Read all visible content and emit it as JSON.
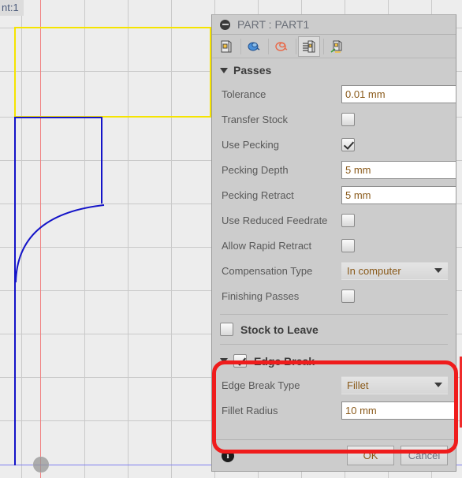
{
  "viewport": {
    "label": "nt:1",
    "origin_icon": "origin-marker-icon",
    "stock_color": "#f5e400",
    "profile_color": "#1414c8",
    "x_axis_color": "#f08080",
    "y_axis_color": "#8080f0",
    "grid_color": "#c9c9c9",
    "background": "#ededed"
  },
  "dialog": {
    "title": "PART : PART1",
    "title_icon": "minus-circle-icon",
    "toolbar": [
      {
        "name": "tool-tab-icon",
        "selected": false
      },
      {
        "name": "geometry-tab-icon",
        "selected": false
      },
      {
        "name": "heights-tab-icon",
        "selected": false
      },
      {
        "name": "passes-tab-icon",
        "selected": true
      },
      {
        "name": "linking-tab-icon",
        "selected": false
      }
    ],
    "groups": [
      {
        "name": "passes",
        "title": "Passes",
        "expanded": true,
        "rows": [
          {
            "type": "spinner",
            "label": "Tolerance",
            "value": "0.01 mm"
          },
          {
            "type": "checkbox",
            "label": "Transfer Stock",
            "checked": false
          },
          {
            "type": "checkbox",
            "label": "Use Pecking",
            "checked": true
          },
          {
            "type": "spinner",
            "label": "Pecking Depth",
            "value": "5 mm"
          },
          {
            "type": "spinner",
            "label": "Pecking Retract",
            "value": "5 mm"
          },
          {
            "type": "checkbox",
            "label": "Use Reduced Feedrate",
            "checked": false
          },
          {
            "type": "checkbox",
            "label": "Allow Rapid Retract",
            "checked": false
          },
          {
            "type": "dropdown",
            "label": "Compensation Type",
            "value": "In computer"
          },
          {
            "type": "checkbox",
            "label": "Finishing Passes",
            "checked": false
          }
        ]
      }
    ],
    "stock_to_leave": {
      "label": "Stock to Leave",
      "checked": false
    },
    "edge_break": {
      "title": "Edge Break",
      "checked": true,
      "expanded": true,
      "highlight_color": "#ef1c1c",
      "rows": [
        {
          "type": "dropdown",
          "label": "Edge Break Type",
          "value": "Fillet"
        },
        {
          "type": "spinner",
          "label": "Fillet Radius",
          "value": "10 mm"
        }
      ]
    },
    "footer": {
      "info_icon": "info-icon",
      "info_glyph": "i",
      "ok_label": "OK",
      "cancel_label": "Cancel"
    }
  }
}
